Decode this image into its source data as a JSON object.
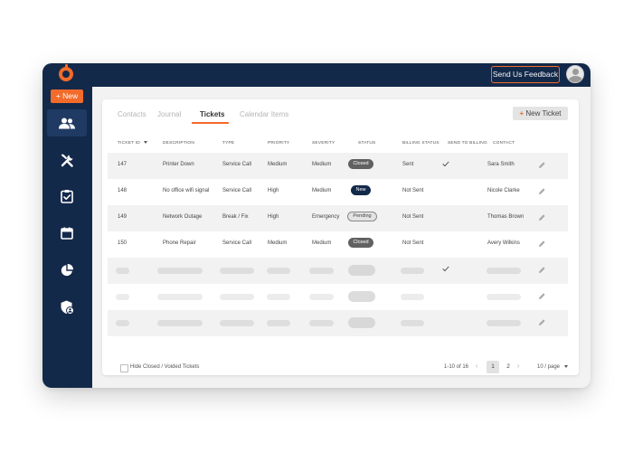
{
  "header": {
    "feedback_label": "Send Us Feedback"
  },
  "sidebar": {
    "new_label": "+ New",
    "items": [
      {
        "icon": "users-icon",
        "active": true
      },
      {
        "icon": "tools-icon",
        "active": false
      },
      {
        "icon": "clipboard-check-icon",
        "active": false
      },
      {
        "icon": "calendar-icon",
        "active": false
      },
      {
        "icon": "pie-chart-icon",
        "active": false
      },
      {
        "icon": "shield-user-icon",
        "active": false
      }
    ]
  },
  "tabs": [
    {
      "label": "Contacts",
      "active": false
    },
    {
      "label": "Journal",
      "active": false
    },
    {
      "label": "Tickets",
      "active": true
    },
    {
      "label": "Calendar Items",
      "active": false
    }
  ],
  "new_ticket_label": "New Ticket",
  "new_ticket_plus": "+",
  "table": {
    "columns": [
      "TICKET ID",
      "DESCRIPTION",
      "TYPE",
      "PRIORITY",
      "SEVERITY",
      "STATUS",
      "BILLING STATUS",
      "SEND TO BILLING",
      "CONTACT"
    ],
    "rows": [
      {
        "id": "147",
        "description": "Printer Down",
        "type": "Service Call",
        "priority": "Medium",
        "severity": "Medium",
        "status": "Closed",
        "billing_status": "Sent",
        "send_to_billing": true,
        "contact": "Sara Smith"
      },
      {
        "id": "148",
        "description": "No office wifi signal",
        "type": "Service Call",
        "priority": "High",
        "severity": "Medium",
        "status": "New",
        "billing_status": "Not Sent",
        "send_to_billing": false,
        "contact": "Nicole Clarke"
      },
      {
        "id": "149",
        "description": "Network Outage",
        "type": "Break / Fix",
        "priority": "High",
        "severity": "Emergency",
        "status": "Pending",
        "billing_status": "Not Sent",
        "send_to_billing": false,
        "contact": "Thomas Brown"
      },
      {
        "id": "150",
        "description": "Phone Repair",
        "type": "Service Call",
        "priority": "Medium",
        "severity": "Medium",
        "status": "Closed",
        "billing_status": "Not Sent",
        "send_to_billing": false,
        "contact": "Avery Wilkins"
      }
    ],
    "placeholder_rows": [
      {
        "send_to_billing": true
      },
      {
        "send_to_billing": false
      },
      {
        "send_to_billing": false
      }
    ]
  },
  "footer": {
    "hide_label": "Hide Closed / Voided Tickets",
    "range_label": "1-10 of 16",
    "pages": [
      "1",
      "2"
    ],
    "current_page": "1",
    "per_page_label": "10 / page"
  },
  "colors": {
    "navy": "#13294a",
    "accent": "#f26b2a"
  }
}
